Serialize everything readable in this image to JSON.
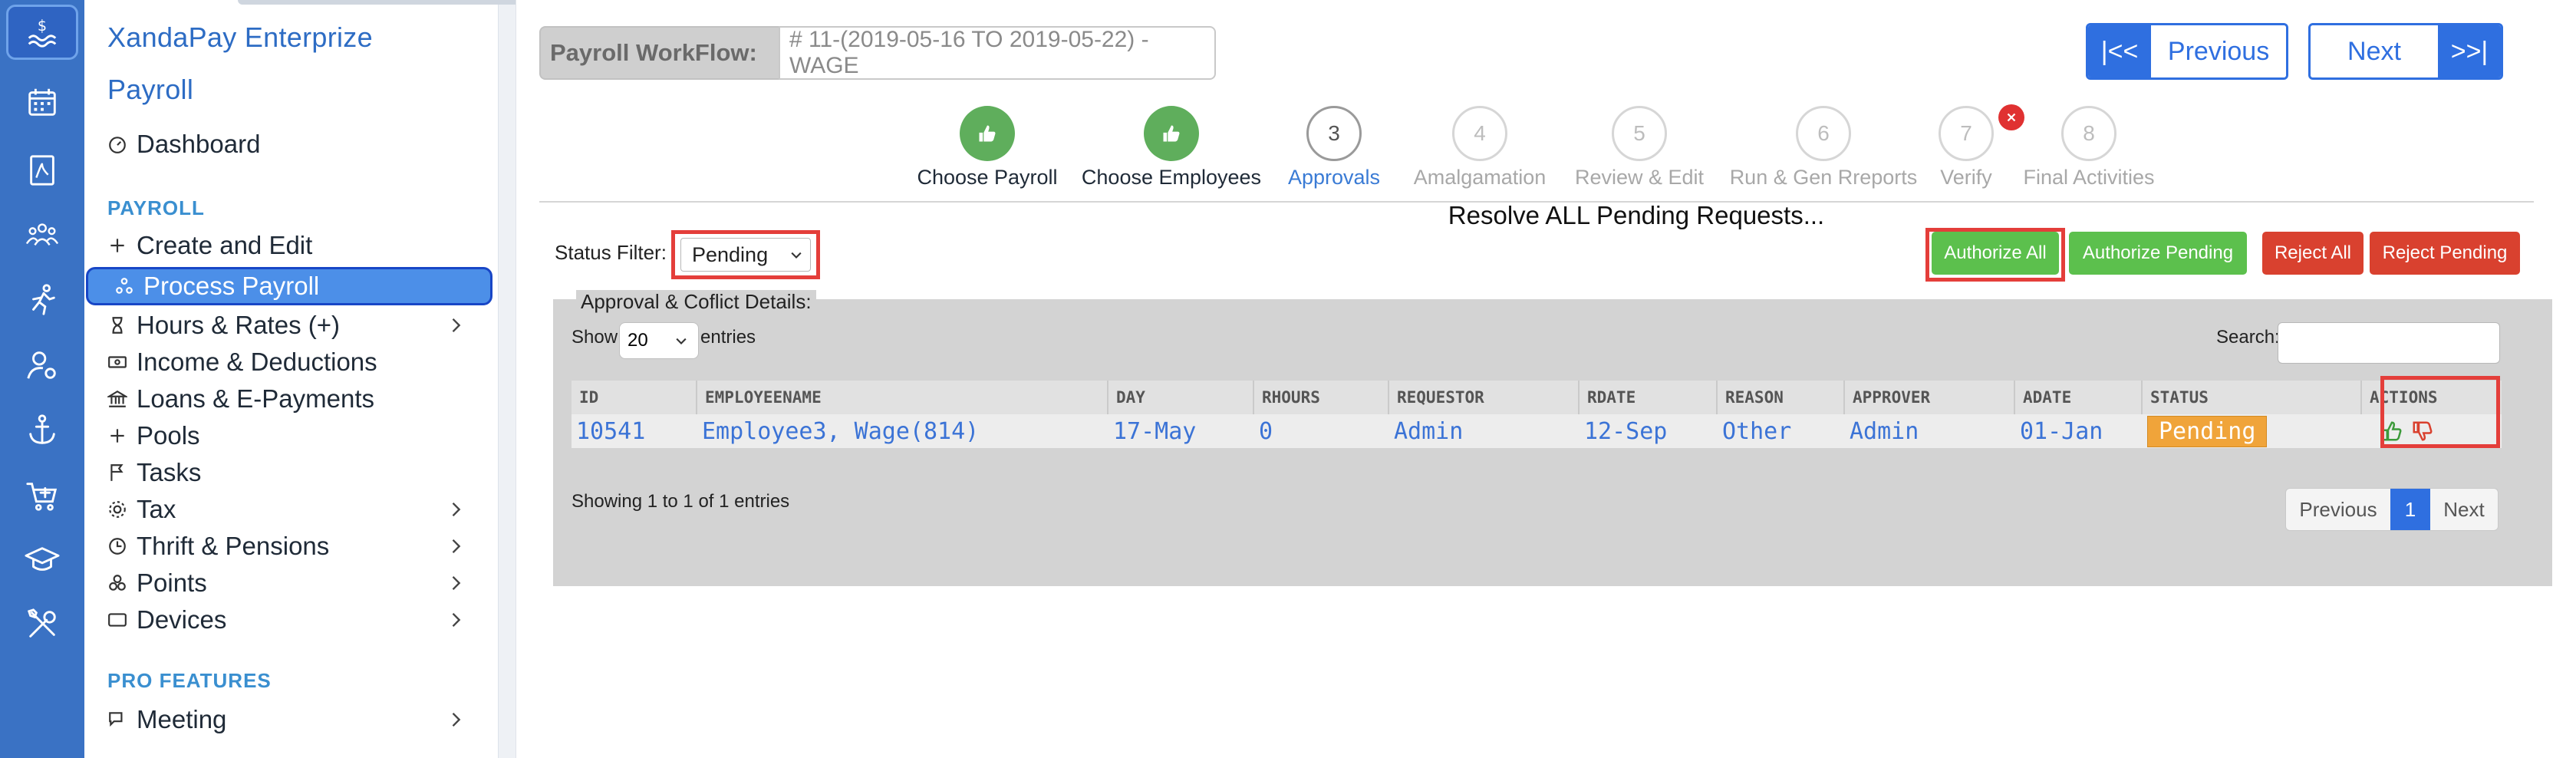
{
  "brand": {
    "line1": "XandaPay Enterprize",
    "line2": "Payroll"
  },
  "sidebar": {
    "dashboard": "Dashboard",
    "section_payroll": "PAYROLL",
    "items": [
      {
        "label": "Create and Edit",
        "icon": "plus-icon"
      },
      {
        "label": "Process Payroll",
        "icon": "process-icon"
      },
      {
        "label": "Hours & Rates (+)",
        "icon": "hourglass-icon"
      },
      {
        "label": "Income & Deductions",
        "icon": "money-icon"
      },
      {
        "label": "Loans & E-Payments",
        "icon": "bank-icon"
      },
      {
        "label": "Pools",
        "icon": "plus-icon"
      },
      {
        "label": "Tasks",
        "icon": "flag-icon"
      },
      {
        "label": "Tax",
        "icon": "gear-icon"
      },
      {
        "label": "Thrift & Pensions",
        "icon": "clock-icon"
      },
      {
        "label": "Points",
        "icon": "points-icon"
      },
      {
        "label": "Devices",
        "icon": "device-icon"
      }
    ],
    "section_pro": "PRO FEATURES",
    "meeting": "Meeting"
  },
  "workflow": {
    "label": "Payroll WorkFlow:",
    "value": "# 11-(2019-05-16 TO 2019-05-22) - WAGE",
    "first_label": "|<<",
    "previous_label": "Previous",
    "next_label": "Next",
    "last_label": ">>|"
  },
  "steps": [
    {
      "num": "",
      "label": "Choose Payroll",
      "state": "done"
    },
    {
      "num": "",
      "label": "Choose Employees",
      "state": "done"
    },
    {
      "num": "3",
      "label": "Approvals",
      "state": "current"
    },
    {
      "num": "4",
      "label": "Amalgamation",
      "state": "todo"
    },
    {
      "num": "5",
      "label": "Review & Edit",
      "state": "todo"
    },
    {
      "num": "6",
      "label": "Run & Gen Rreports",
      "state": "todo"
    },
    {
      "num": "7",
      "label": "Verify",
      "state": "todo"
    },
    {
      "num": "8",
      "label": "Final Activities",
      "state": "todo"
    }
  ],
  "resolve_text": "Resolve ALL Pending Requests...",
  "status_filter": {
    "label": "Status Filter:",
    "value": "Pending"
  },
  "actions": {
    "authorize_all": "Authorize All",
    "authorize_pending": "Authorize Pending",
    "reject_all": "Reject All",
    "reject_pending": "Reject Pending"
  },
  "panel": {
    "legend": "Approval & Coflict Details:",
    "show_label": "Show",
    "show_value": "20",
    "entries_label": "entries",
    "search_label": "Search:",
    "showing_text": "Showing 1 to 1 of 1 entries",
    "pager": {
      "previous": "Previous",
      "page": "1",
      "next": "Next"
    }
  },
  "table": {
    "headers": [
      "ID",
      "EMPLOYEENAME",
      "DAY",
      "RHOURS",
      "REQUESTOR",
      "RDATE",
      "REASON",
      "APPROVER",
      "ADATE",
      "STATUS",
      "ACTIONS"
    ],
    "row": [
      "10541",
      "Employee3, Wage(814)",
      "17-May",
      "0",
      "Admin",
      "12-Sep",
      "Other",
      "Admin",
      "01-Jan",
      "Pending"
    ]
  },
  "colors": {
    "rail": "#3a72c4",
    "accent": "#2f6fe0",
    "success": "#5cc04d",
    "danger": "#d9412f",
    "highlight": "#e43e3a",
    "pending": "#f0a43a"
  }
}
